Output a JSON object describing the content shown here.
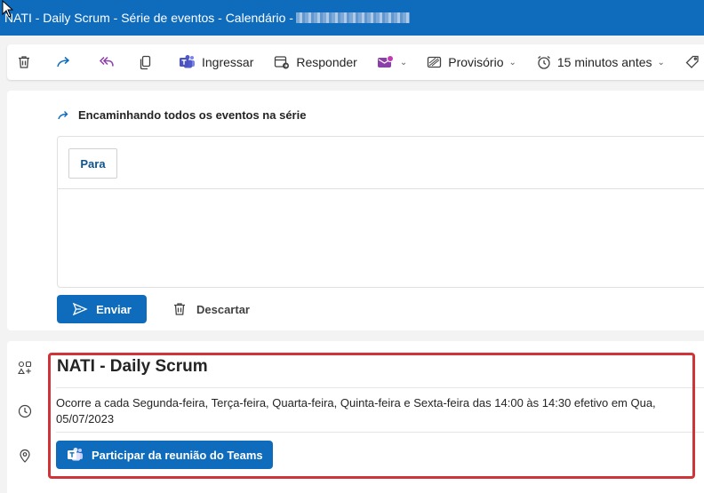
{
  "window": {
    "title": "NATI - Daily Scrum - Série de eventos - Calendário - "
  },
  "toolbar": {
    "join_label": "Ingressar",
    "reply_label": "Responder",
    "status_label": "Provisório",
    "reminder_label": "15 minutos antes",
    "category_label_partial": "Ca"
  },
  "forward": {
    "heading": "Encaminhando todos os eventos na série",
    "to_label": "Para",
    "send_label": "Enviar",
    "discard_label": "Descartar"
  },
  "event": {
    "title": "NATI - Daily Scrum",
    "recurrence": "Ocorre a cada Segunda-feira, Terça-feira, Quarta-feira, Quinta-feira e Sexta-feira das 14:00 às 14:30 efetivo em Qua, 05/07/2023",
    "teams_button": "Participar da reunião do Teams"
  },
  "colors": {
    "brand": "#0f6cbd",
    "highlight": "#d13438"
  }
}
